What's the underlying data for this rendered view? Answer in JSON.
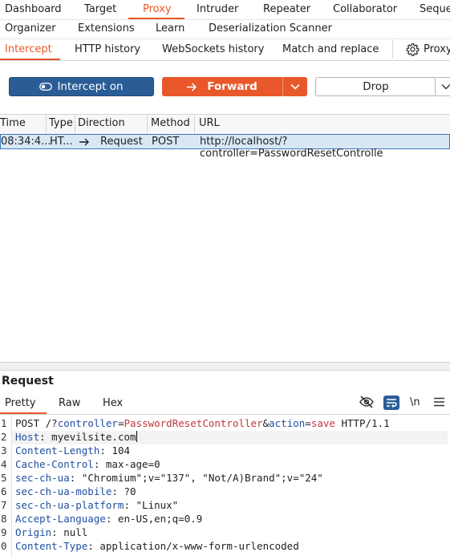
{
  "main_tabs": [
    "Dashboard",
    "Target",
    "Proxy",
    "Intruder",
    "Repeater",
    "Collaborator",
    "Seque"
  ],
  "active_main_tab": "Proxy",
  "secondary_tabs": [
    "Organizer",
    "Extensions",
    "Learn",
    "Deserialization Scanner"
  ],
  "proxy_tabs": [
    "Intercept",
    "HTTP history",
    "WebSockets history",
    "Match and replace",
    "Proxy"
  ],
  "active_proxy_tab": "Intercept",
  "toolbar": {
    "intercept_label": "Intercept on",
    "forward_label": "Forward",
    "drop_label": "Drop"
  },
  "table": {
    "columns": [
      "Time",
      "Type",
      "Direction",
      "Method",
      "URL"
    ],
    "rows": [
      {
        "time": "08:34:4...",
        "type": "HT...",
        "direction": "Request",
        "method": "POST",
        "url": "http://localhost/?controller=PasswordResetControlle"
      }
    ]
  },
  "request_panel": {
    "title": "Request",
    "tabs": [
      "Pretty",
      "Raw",
      "Hex"
    ],
    "active_tab": "Pretty",
    "newline_toggle_label": "\\n",
    "line_numbers": [
      "1",
      "2",
      "3",
      "4",
      "5",
      "6",
      "7",
      "8",
      "9",
      "0"
    ],
    "request_line": {
      "method": "POST",
      "path_prefix": "/?",
      "param1_name": "controller",
      "param1_value": "PasswordResetController",
      "param2_name": "action",
      "param2_value": "save",
      "version": "HTTP/1.1"
    },
    "headers": [
      {
        "name": "Host",
        "value": "myevilsite.com"
      },
      {
        "name": "Content-Length",
        "value": "104"
      },
      {
        "name": "Cache-Control",
        "value": "max-age=0"
      },
      {
        "name": "sec-ch-ua",
        "value": "\"Chromium\";v=\"137\", \"Not/A)Brand\";v=\"24\""
      },
      {
        "name": "sec-ch-ua-mobile",
        "value": "?0"
      },
      {
        "name": "sec-ch-ua-platform",
        "value": "\"Linux\""
      },
      {
        "name": "Accept-Language",
        "value": "en-US,en;q=0.9"
      },
      {
        "name": "Origin",
        "value": "null"
      },
      {
        "name": "Content-Type",
        "value": "application/x-www-form-urlencoded"
      }
    ]
  },
  "colors": {
    "accent": "#e8582b",
    "intercept_button": "#2a5d96",
    "selected_row": "#d9e7f5",
    "header_name": "#1f4fa0",
    "param_value": "#c4343a"
  }
}
